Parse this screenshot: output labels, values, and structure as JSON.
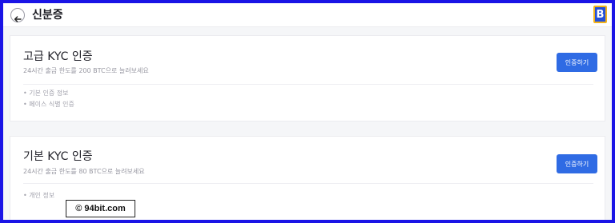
{
  "header": {
    "back_icon": "arrow-left-icon",
    "title": "신분증",
    "logo_letter": "B",
    "logo_colors": {
      "fill": "#2450d8",
      "border": "#f2b21a"
    }
  },
  "cards": [
    {
      "title": "고급 KYC 인증",
      "subtitle": "24시간 출금 한도를 200 BTC으로 늘려보세요",
      "items": [
        "• 기본 인증 정보",
        "• 페이스 식별 인증"
      ],
      "button_label": "인증하기"
    },
    {
      "title": "기본 KYC 인증",
      "subtitle": "24시간 출금 한도를 80 BTC으로 늘려보세요",
      "items": [
        "• 개인 정보"
      ],
      "button_label": "인증하기"
    }
  ],
  "watermark": "© 94bit.com",
  "colors": {
    "frame": "#1a14e6",
    "accent": "#2f6be4",
    "background": "#f5f6f8"
  }
}
